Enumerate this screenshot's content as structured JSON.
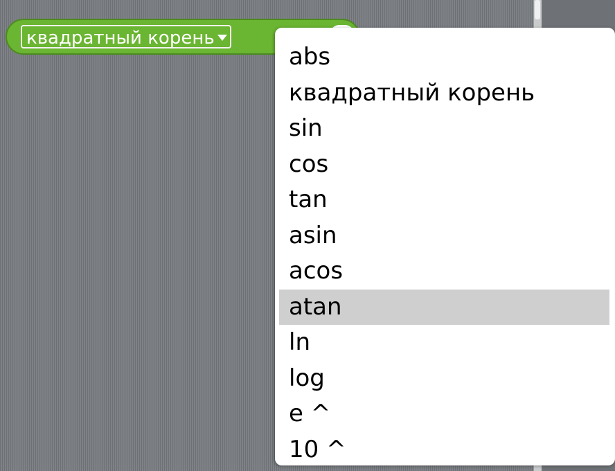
{
  "block": {
    "selected_function": "квадратный корень"
  },
  "dropdown_menu": {
    "items": [
      {
        "label": "abs"
      },
      {
        "label": "квадратный корень"
      },
      {
        "label": "sin"
      },
      {
        "label": "cos"
      },
      {
        "label": "tan"
      },
      {
        "label": "asin"
      },
      {
        "label": "acos"
      },
      {
        "label": "atan",
        "highlighted": true
      },
      {
        "label": "ln"
      },
      {
        "label": "log"
      },
      {
        "label": "e ^"
      },
      {
        "label": "10 ^"
      }
    ]
  },
  "colors": {
    "block_green": "#6ab531",
    "block_border": "#4c8a1f",
    "script_area": "#74787c",
    "highlight": "#cfcfcf"
  }
}
